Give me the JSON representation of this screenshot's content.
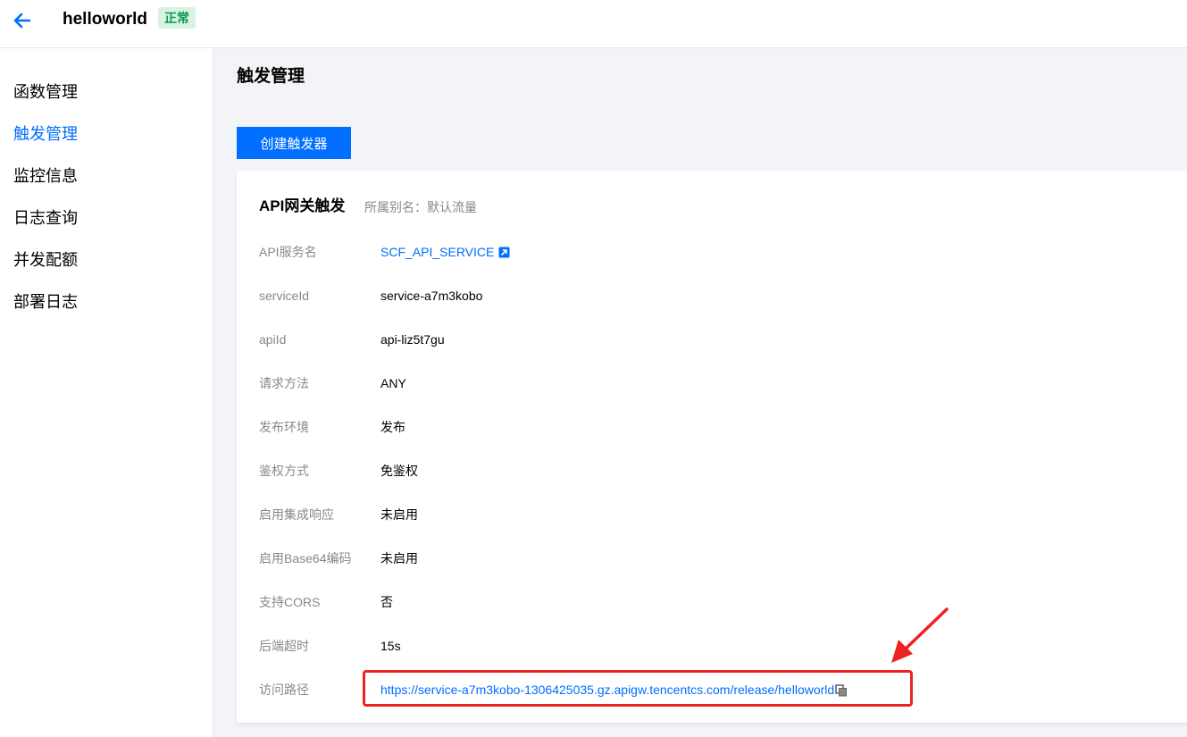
{
  "header": {
    "title": "helloworld",
    "status": "正常"
  },
  "sidebar": {
    "items": [
      {
        "label": "函数管理"
      },
      {
        "label": "触发管理"
      },
      {
        "label": "监控信息"
      },
      {
        "label": "日志查询"
      },
      {
        "label": "并发配额"
      },
      {
        "label": "部署日志"
      }
    ],
    "active_index": 1
  },
  "main": {
    "page_title": "触发管理",
    "create_button": "创建触发器",
    "card": {
      "title": "API网关触发",
      "subtitle": "所属别名：默认流量",
      "rows": [
        {
          "label": "API服务名",
          "value": "SCF_API_SERVICE"
        },
        {
          "label": "serviceId",
          "value": "service-a7m3kobo"
        },
        {
          "label": "apiId",
          "value": "api-liz5t7gu"
        },
        {
          "label": "请求方法",
          "value": "ANY"
        },
        {
          "label": "发布环境",
          "value": "发布"
        },
        {
          "label": "鉴权方式",
          "value": "免鉴权"
        },
        {
          "label": "启用集成响应",
          "value": "未启用"
        },
        {
          "label": "启用Base64编码",
          "value": "未启用"
        },
        {
          "label": "支持CORS",
          "value": "否"
        },
        {
          "label": "后端超时",
          "value": "15s"
        },
        {
          "label": "访问路径",
          "value": "https://service-a7m3kobo-1306425035.gz.apigw.tencentcs.com/release/helloworld"
        }
      ]
    }
  },
  "colors": {
    "accent": "#006eff",
    "status_bg": "#d7f3e3",
    "status_text": "#0a9a4a",
    "annotation": "#ee2222"
  }
}
